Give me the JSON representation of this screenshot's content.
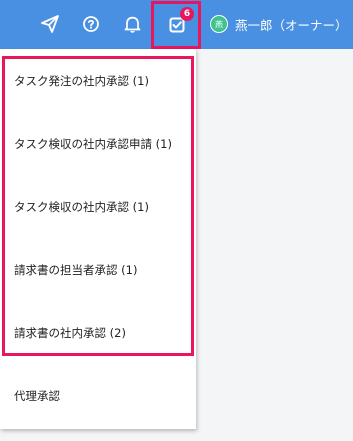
{
  "header": {
    "icons": [
      "paper-plane-icon",
      "help-icon",
      "bell-icon",
      "check-square-icon"
    ],
    "notification_count": "6",
    "user": {
      "avatar_initial": "燕",
      "name": "燕一郎（オーナー）"
    }
  },
  "menu": {
    "items": [
      {
        "label": "タスク発注の社内承認 (1)"
      },
      {
        "label": "タスク検収の社内承認申請 (1)"
      },
      {
        "label": "タスク検収の社内承認 (1)"
      },
      {
        "label": "請求書の担当者承認 (1)"
      },
      {
        "label": "請求書の社内承認 (2)"
      },
      {
        "label": "代理承認"
      }
    ]
  },
  "colors": {
    "header_bg": "#4a90e2",
    "highlight": "#e8175d",
    "avatar": "#3ec28f"
  }
}
